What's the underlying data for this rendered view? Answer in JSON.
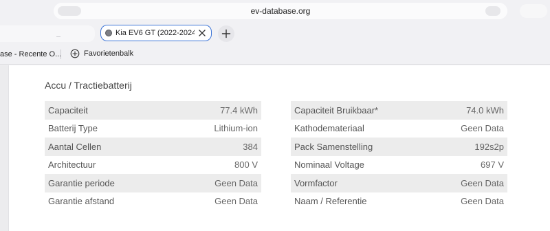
{
  "browser": {
    "url": "ev-database.org",
    "tab": {
      "title": "Kia EV6 GT (2022-2024) ..."
    },
    "bookmarks": {
      "item1": "ase - Recente O...",
      "favorites": "Favorietenbalk"
    }
  },
  "section": {
    "title": "Accu / Tractiebatterij"
  },
  "spec_left": [
    {
      "label": "Capaciteit",
      "value": "77.4 kWh"
    },
    {
      "label": "Batterij Type",
      "value": "Lithium-ion"
    },
    {
      "label": "Aantal Cellen",
      "value": "384"
    },
    {
      "label": "Architectuur",
      "value": "800 V"
    },
    {
      "label": "Garantie periode",
      "value": "Geen Data"
    },
    {
      "label": "Garantie afstand",
      "value": "Geen Data"
    }
  ],
  "spec_right": [
    {
      "label": "Capaciteit Bruikbaar*",
      "value": "74.0 kWh"
    },
    {
      "label": "Kathodemateriaal",
      "value": "Geen Data"
    },
    {
      "label": "Pack Samenstelling",
      "value": "192s2p"
    },
    {
      "label": "Nominaal Voltage",
      "value": "697 V"
    },
    {
      "label": "Vormfactor",
      "value": "Geen Data"
    },
    {
      "label": "Naam / Referentie",
      "value": "Geen Data"
    }
  ],
  "colors": {
    "row_shade": "#ececec",
    "tab_border": "#3c74d6"
  }
}
